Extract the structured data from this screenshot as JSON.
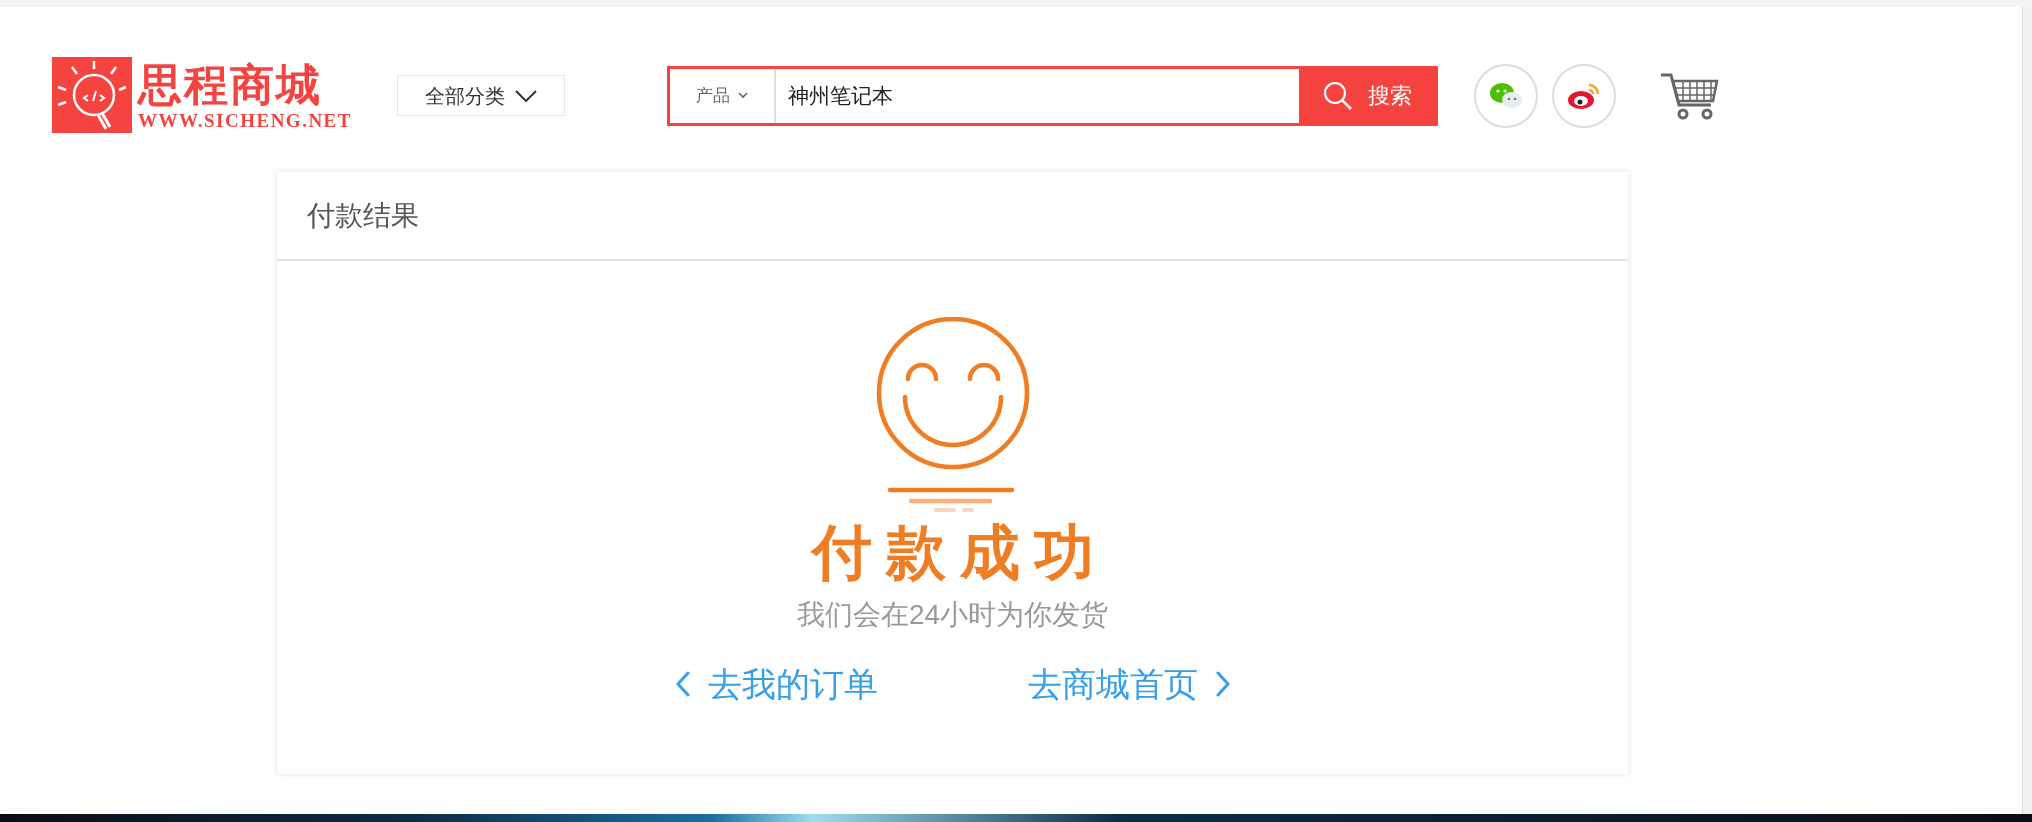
{
  "header": {
    "logo": {
      "name": "思程商城",
      "url": "WWW.SICHENG.NET"
    },
    "category_button": "全部分类",
    "search": {
      "scope": "产品",
      "value": "神州笔记本",
      "button": "搜索"
    }
  },
  "panel": {
    "title": "付款结果",
    "result": {
      "title": "付款成功",
      "message": "我们会在24小时为你发货"
    },
    "links": [
      {
        "kind": "back",
        "label": "去我的订单"
      },
      {
        "kind": "forward",
        "label": "去商城首页"
      }
    ]
  }
}
